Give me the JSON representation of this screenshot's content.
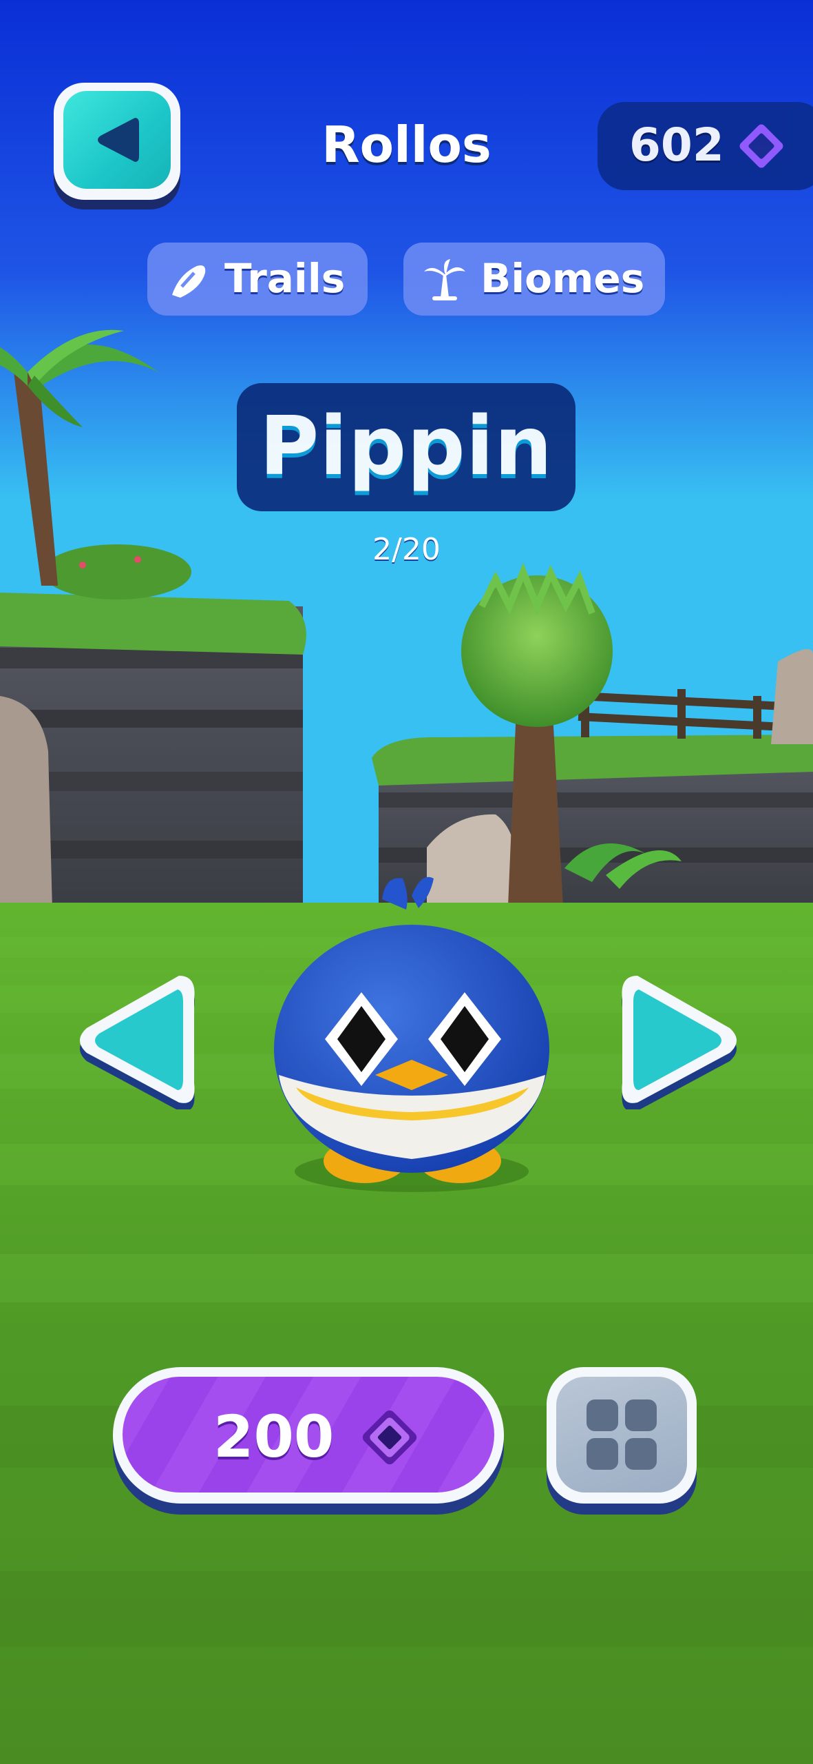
{
  "header": {
    "title": "Rollos",
    "currency": {
      "value": "602",
      "icon": "gem-icon",
      "color": "#9b5cff"
    }
  },
  "tabs": [
    {
      "label": "Trails",
      "icon": "trail-icon"
    },
    {
      "label": "Biomes",
      "icon": "palm-tree-icon"
    }
  ],
  "character": {
    "name": "Pippin",
    "counter": "2/20"
  },
  "actions": {
    "buy_price": "200",
    "buy_icon": "gem-icon",
    "grid_icon": "grid-icon"
  },
  "colors": {
    "sky_top": "#0a2fd6",
    "sky_bottom": "#38c0f2",
    "grass": "#5aa82a",
    "accent_teal": "#2bd4d0",
    "buy_purple": "#a44ef0"
  }
}
